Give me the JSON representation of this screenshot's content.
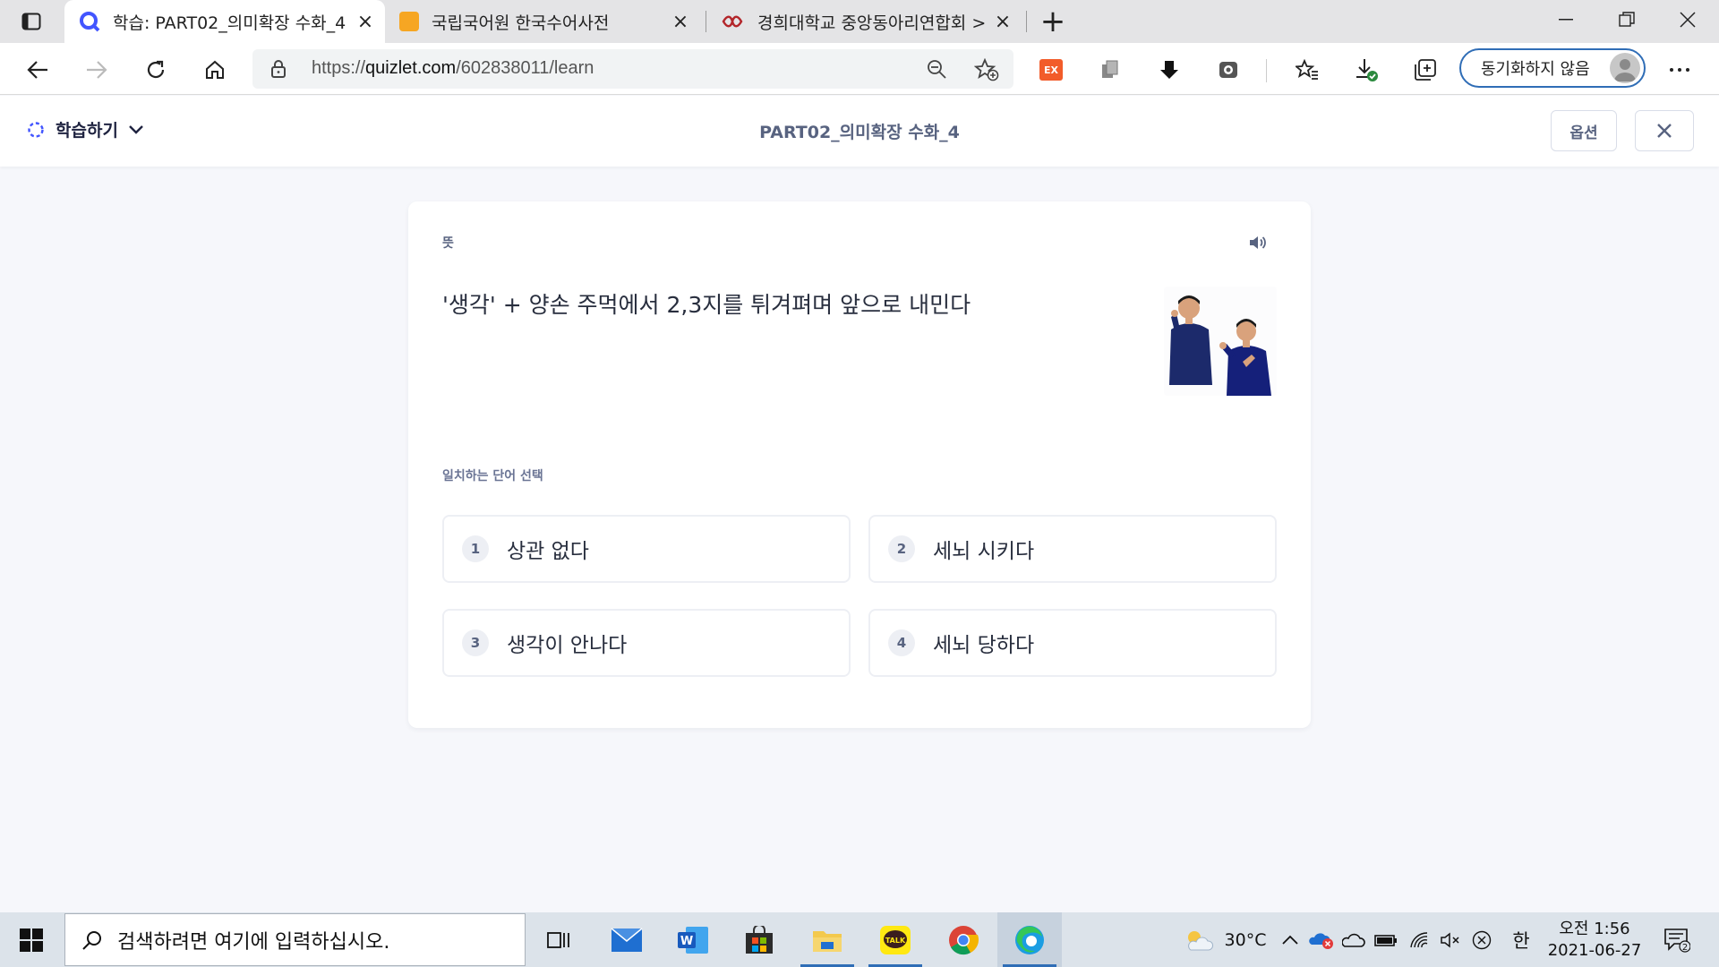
{
  "browser": {
    "tabs": [
      {
        "title": "학습: PART02_의미확장 수화_4 | Q",
        "favicon": "quizlet-icon"
      },
      {
        "title": "국립국어원 한국수어사전",
        "favicon": "dictionary-icon"
      },
      {
        "title": "경희대학교 중앙동아리연합회 >",
        "favicon": "club-icon"
      }
    ],
    "new_tab": "+",
    "url_prefix": "https://",
    "url_host": "quizlet.com",
    "url_path": "/602838011/learn",
    "ext_badge": "EX",
    "sync_label": "동기화하지 않음"
  },
  "app": {
    "mode_label": "학습하기",
    "set_title": "PART02_의미확장 수화_4",
    "options_label": "옵션"
  },
  "question": {
    "label": "뜻",
    "prompt": "'생각' + 양손 주먹에서 2,3지를 튀겨펴며 앞으로 내민다",
    "instruction": "일치하는 단어 선택",
    "choices": [
      {
        "num": "1",
        "text": "상관 없다"
      },
      {
        "num": "2",
        "text": "세뇌 시키다"
      },
      {
        "num": "3",
        "text": "생각이 안나다"
      },
      {
        "num": "4",
        "text": "세뇌 당하다"
      }
    ]
  },
  "taskbar": {
    "search_placeholder": "검색하려면 여기에 입력하십시오.",
    "weather": "30°C",
    "ime": "한",
    "time": "오전 1:56",
    "date": "2021-06-27",
    "notifications": "2"
  },
  "colors": {
    "accent": "#4255ff",
    "text_dark": "#282e3e",
    "text_muted": "#586380",
    "border": "#edeff4",
    "edge_blue": "#2f6db6"
  }
}
